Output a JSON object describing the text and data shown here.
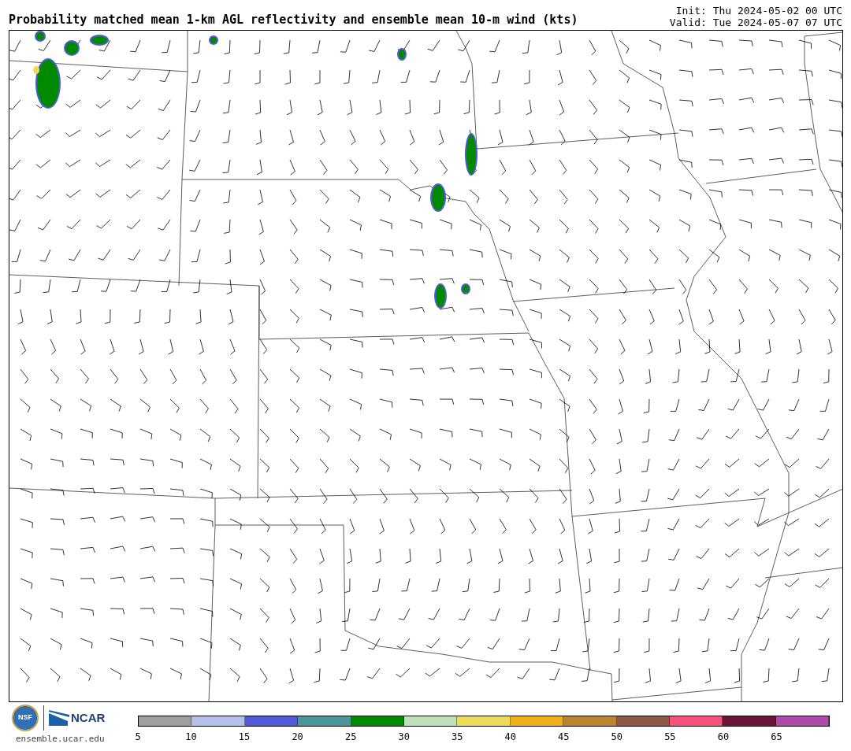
{
  "title": "Probability matched mean 1-km AGL reflectivity and ensemble mean 10-m wind (kts)",
  "init": "Init: Thu 2024-05-02 00 UTC",
  "valid": "Valid: Tue 2024-05-07 07 UTC",
  "colorbar": {
    "segments": [
      {
        "color": "#a0a0a0"
      },
      {
        "color": "#b4c0ea"
      },
      {
        "color": "#525ad9"
      },
      {
        "color": "#4c959b"
      },
      {
        "color": "#008a00"
      },
      {
        "color": "#bee0bb"
      },
      {
        "color": "#efdb5a"
      },
      {
        "color": "#eeb016"
      },
      {
        "color": "#bb8430"
      },
      {
        "color": "#8d5b43"
      },
      {
        "color": "#f5527c"
      },
      {
        "color": "#6b1638"
      },
      {
        "color": "#ad4aac"
      }
    ],
    "ticks": [
      "5",
      "10",
      "15",
      "20",
      "25",
      "30",
      "35",
      "40",
      "45",
      "50",
      "55",
      "60",
      "65"
    ]
  },
  "logo": {
    "nsf": "NSF",
    "ncar": "NCAR"
  },
  "footer": "ensemble.ucar.edu"
}
